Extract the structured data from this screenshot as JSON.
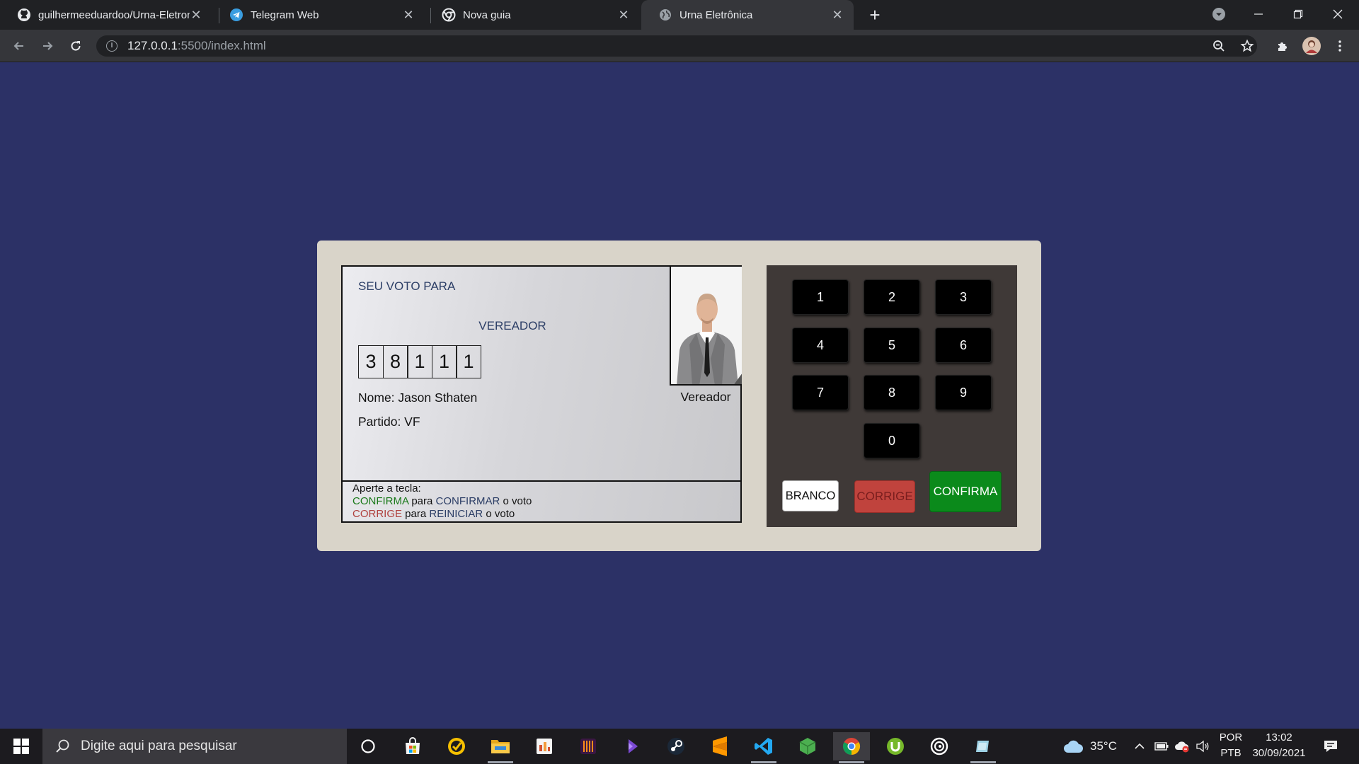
{
  "browser": {
    "tabs": [
      {
        "title": "guilhermeeduardoo/Urna-Eletron",
        "icon": "github-icon"
      },
      {
        "title": "Telegram Web",
        "icon": "telegram-icon"
      },
      {
        "title": "Nova guia",
        "icon": "chrome-icon"
      },
      {
        "title": "Urna Eletrônica",
        "icon": "globe-icon"
      }
    ],
    "active_tab": 3,
    "url_host": "127.0.0.1",
    "url_path": ":5500/index.html"
  },
  "urna": {
    "seu_voto_label": "SEU VOTO PARA",
    "cargo": "VEREADOR",
    "numeros": [
      "3",
      "8",
      "1",
      "1",
      "1"
    ],
    "nome": "Nome: Jason Sthaten",
    "partido": "Partido: VF",
    "foto_legenda": "Vereador",
    "aviso": {
      "linha1": "Aperte a tecla:",
      "confirma": "CONFIRMA",
      "para1": " para ",
      "confirmar": "CONFIRMAR",
      "o_voto1": " o voto",
      "corrige": "CORRIGE",
      "para2": " para ",
      "reiniciar": "REINICIAR",
      "o_voto2": " o voto"
    },
    "teclas": [
      "1",
      "2",
      "3",
      "4",
      "5",
      "6",
      "7",
      "8",
      "9",
      "0"
    ],
    "branco_label": "BRANCO",
    "corrige_label": "CORRIGE",
    "confirma_label": "CONFIRMA"
  },
  "taskbar": {
    "search_placeholder": "Digite aqui para pesquisar",
    "temperature": "35°C",
    "lang1": "POR",
    "lang2": "PTB",
    "time": "13:02",
    "date": "30/09/2021"
  },
  "colors": {
    "page_bg": "#2c3166",
    "urna_body": "#d9d4c9",
    "keypad_bg": "#3f3937",
    "confirma": "#0b8a1b",
    "corrige": "#c0433d"
  }
}
